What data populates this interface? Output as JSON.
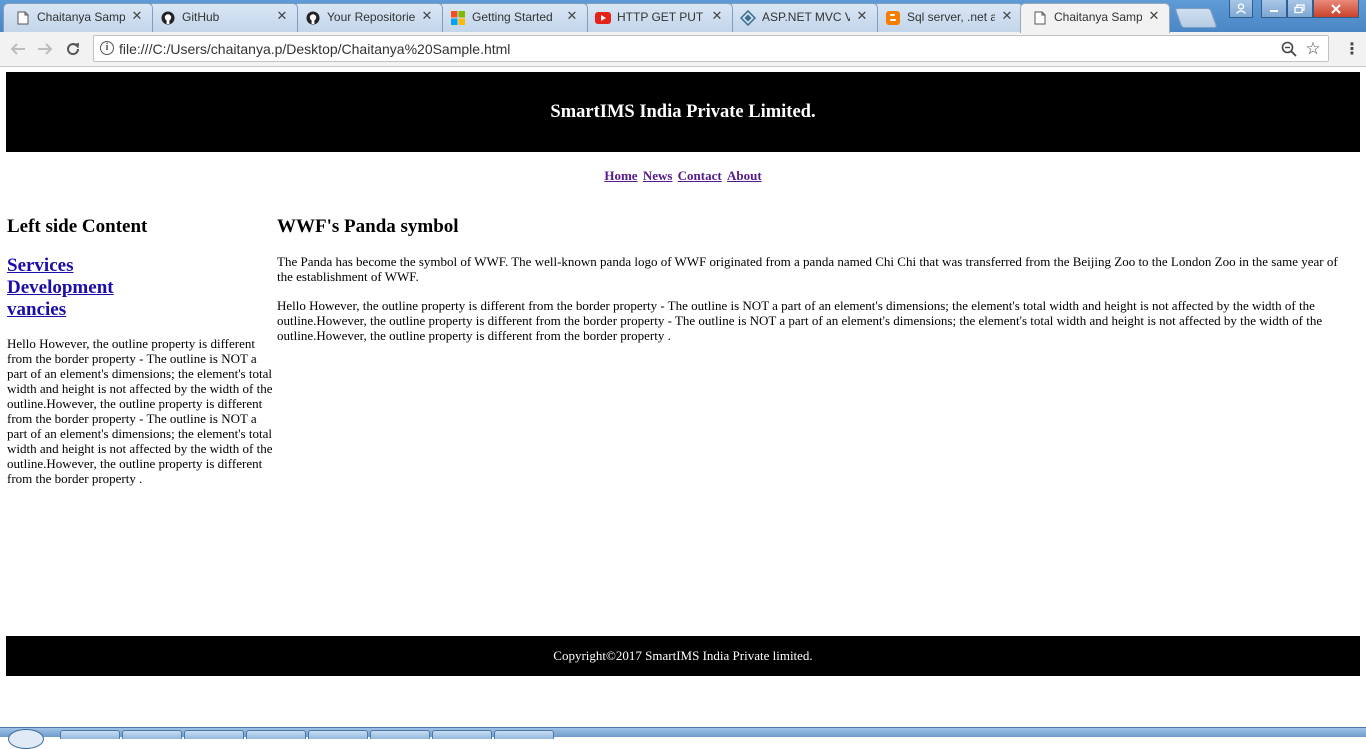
{
  "browser": {
    "tabs": [
      {
        "title": "Chaitanya Sample",
        "favicon": "document-icon",
        "active": false
      },
      {
        "title": "GitHub",
        "favicon": "github-icon",
        "active": false
      },
      {
        "title": "Your Repositories",
        "favicon": "github-icon",
        "active": false
      },
      {
        "title": "Getting Started",
        "favicon": "microsoft-icon",
        "active": false
      },
      {
        "title": "HTTP GET PUT P",
        "favicon": "youtube-icon",
        "active": false
      },
      {
        "title": "ASP.NET MVC V",
        "favicon": "aspnet-icon",
        "active": false
      },
      {
        "title": "Sql server, .net a",
        "favicon": "blogger-icon",
        "active": false
      },
      {
        "title": "Chaitanya Samp",
        "favicon": "document-icon",
        "active": true
      }
    ],
    "tab_close_glyph": "✕",
    "url": "file:///C:/Users/chaitanya.p/Desktop/Chaitanya%20Sample.html",
    "colors": {
      "chrome_blue": "#4a86c5",
      "toolbar": "#f2f2f2"
    }
  },
  "page": {
    "header_title": "SmartIMS India Private Limited.",
    "nav": [
      "Home",
      "News",
      "Contact",
      "About"
    ],
    "left": {
      "heading": "Left side Content",
      "links": [
        "Services",
        "Development",
        "vancies"
      ],
      "text": "Hello However, the outline property is different from the border property - The outline is NOT a part of an element's dimensions; the element's total width and height is not affected by the width of the outline.However, the outline property is different from the border property - The outline is NOT a part of an element's dimensions; the element's total width and height is not affected by the width of the outline.However, the outline property is different from the border property ."
    },
    "main": {
      "heading": "WWF's Panda symbol",
      "paragraph1": "The Panda has become the symbol of WWF. The well-known panda logo of WWF originated from a panda named Chi Chi that was transferred from the Beijing Zoo to the London Zoo in the same year of the establishment of WWF.",
      "paragraph2": "Hello However, the outline property is different from the border property - The outline is NOT a part of an element's dimensions; the element's total width and height is not affected by the width of the outline.However, the outline property is different from the border property - The outline is NOT a part of an element's dimensions; the element's total width and height is not affected by the width of the outline.However, the outline property is different from the border property ."
    },
    "footer": "Copyright©2017 SmartIMS India Private limited.",
    "colors": {
      "header_bg": "#000000",
      "footer_bg": "#000000",
      "visited_link": "#551a8b",
      "link": "#1a0dab"
    }
  }
}
